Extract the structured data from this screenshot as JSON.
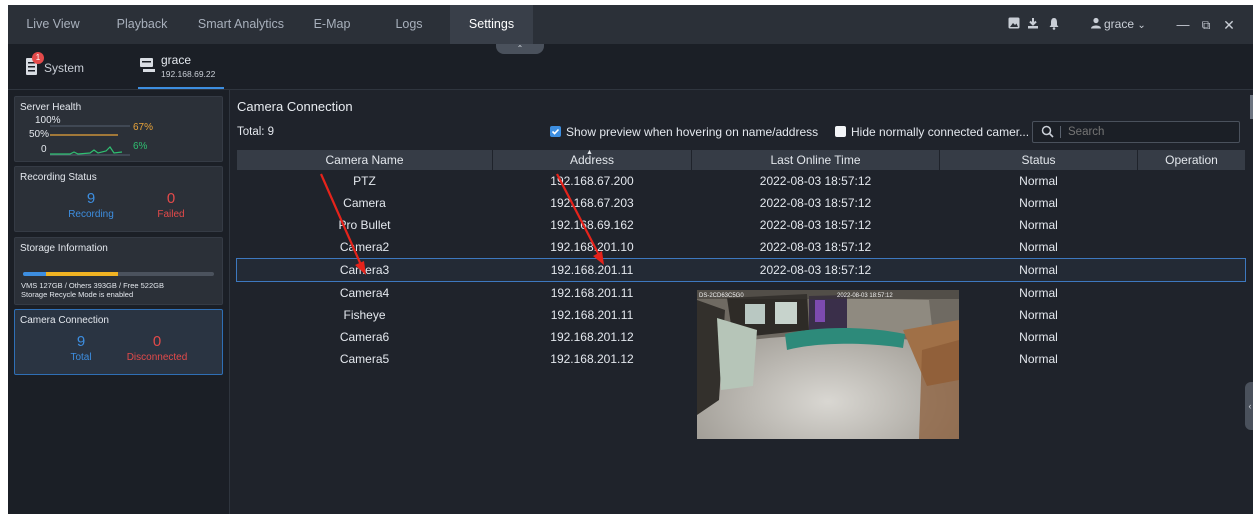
{
  "topbar": {
    "tabs": [
      {
        "label": "Live View"
      },
      {
        "label": "Playback"
      },
      {
        "label": "Smart Analytics"
      },
      {
        "label": "E-Map"
      },
      {
        "label": "Logs"
      },
      {
        "label": "Settings"
      }
    ],
    "user": "grace",
    "active_tab": "Settings"
  },
  "subbar": {
    "system_label": "System",
    "system_badge": "1",
    "server_name": "grace",
    "server_ip": "192.168.69.22"
  },
  "sidebar": {
    "server_health": {
      "title": "Server Health",
      "label_100": "100%",
      "label_50": "50%",
      "label_0": "0",
      "cpu": "67%",
      "other": "6%"
    },
    "recording": {
      "title": "Recording Status",
      "recording_count": "9",
      "recording_label": "Recording",
      "failed_count": "0",
      "failed_label": "Failed"
    },
    "storage": {
      "title": "Storage Information",
      "line1": "VMS 127GB / Others 393GB / Free 522GB",
      "line2": "Storage Recycle Mode is enabled",
      "vms_fraction": 0.122,
      "others_fraction": 0.377
    },
    "camera_connection": {
      "title": "Camera Connection",
      "total_count": "9",
      "total_label": "Total",
      "disconnected_count": "0",
      "disconnected_label": "Disconnected"
    }
  },
  "main": {
    "title": "Camera Connection",
    "total": "Total: 9",
    "show_preview_label": "Show preview when hovering on name/address",
    "hide_connected_label": "Hide normally connected camer...",
    "search_placeholder": "Search",
    "columns": [
      "Camera Name",
      "Address",
      "Last Online Time",
      "Status",
      "Operation"
    ],
    "rows": [
      {
        "name": "PTZ",
        "address": "192.168.67.200",
        "time": "2022-08-03 18:57:12",
        "status": "Normal"
      },
      {
        "name": "Camera",
        "address": "192.168.67.203",
        "time": "2022-08-03 18:57:12",
        "status": "Normal"
      },
      {
        "name": "Pro Bullet",
        "address": "192.168.69.162",
        "time": "2022-08-03 18:57:12",
        "status": "Normal"
      },
      {
        "name": "Camera2",
        "address": "192.168.201.10",
        "time": "2022-08-03 18:57:12",
        "status": "Normal"
      },
      {
        "name": "Camera3",
        "address": "192.168.201.11",
        "time": "2022-08-03 18:57:12",
        "status": "Normal"
      },
      {
        "name": "Camera4",
        "address": "192.168.201.11",
        "time": "",
        "status": "Normal"
      },
      {
        "name": "Fisheye",
        "address": "192.168.201.11",
        "time": "",
        "status": "Normal"
      },
      {
        "name": "Camera6",
        "address": "192.168.201.12",
        "time": "",
        "status": "Normal"
      },
      {
        "name": "Camera5",
        "address": "192.168.201.12",
        "time": "",
        "status": "Normal"
      }
    ],
    "preview_timestamp": "2022-08-03 18:57:12"
  },
  "colors": {
    "accent": "#3d8ee0",
    "danger": "#e34a4a",
    "warn": "#e8a33a",
    "annotation": "#e5231b"
  }
}
